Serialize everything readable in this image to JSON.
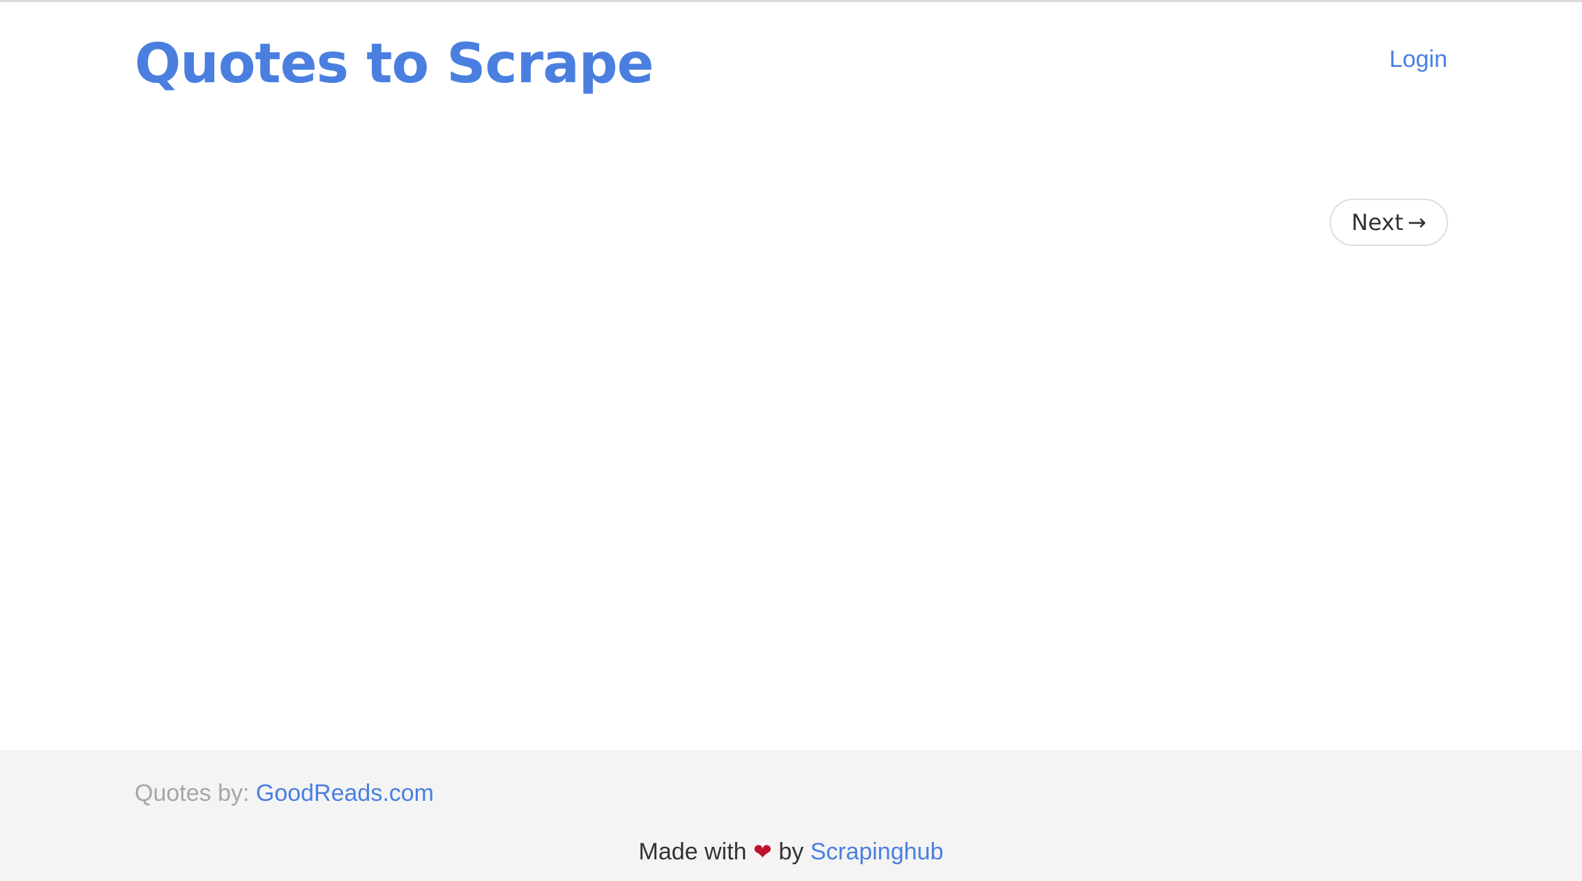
{
  "header": {
    "site_title": "Quotes to Scrape",
    "login_label": "Login"
  },
  "pager": {
    "next_label": "Next",
    "next_arrow": "→"
  },
  "footer": {
    "source_label": "Quotes by: ",
    "source_link": "GoodReads.com",
    "made_with": "Made with",
    "heart": "❤",
    "by": "by",
    "company_link": "Scrapinghub"
  },
  "colors": {
    "link": "#4a7fe0",
    "heart": "#c0102c",
    "footer_bg": "#f4f4f4",
    "muted_text": "#a6a6a6"
  },
  "icons": {
    "heart": "heart-icon",
    "next_arrow": "arrow-right-icon"
  }
}
